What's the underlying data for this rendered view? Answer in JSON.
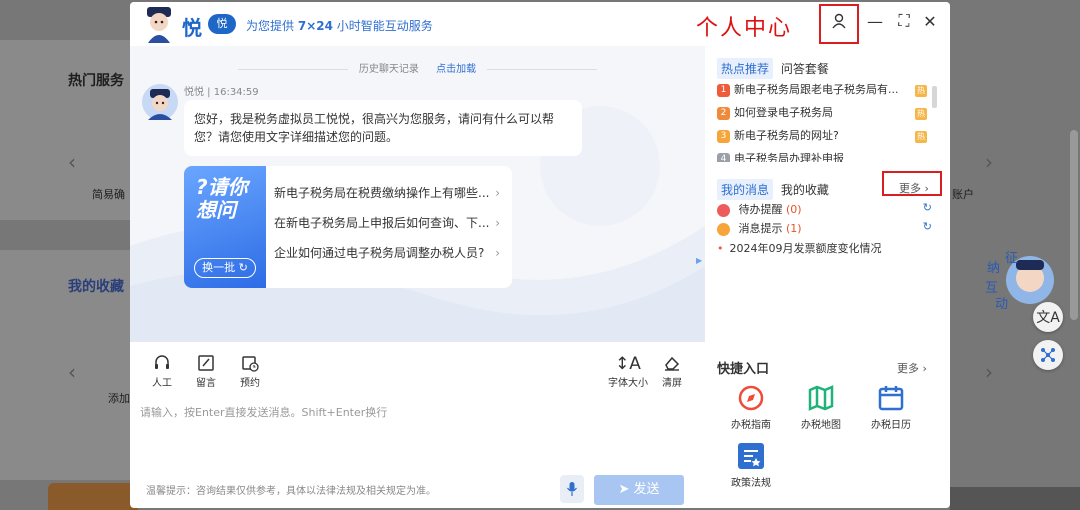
{
  "background": {
    "hot_services_label": "热门服务",
    "favorites_label": "我的收藏",
    "easy_label": "简易确",
    "add_label": "添加",
    "right_label": "账户"
  },
  "header": {
    "brand": "悦",
    "brand_badge": "悦",
    "tagline_prefix": "为您提供",
    "tagline_bold": "7×24",
    "tagline_suffix": "小时智能互动服务",
    "annotation": "个人中心",
    "user_icon": "person-icon",
    "minimize": "—",
    "maximize": "⛶",
    "close": "✕"
  },
  "chat": {
    "history_label": "历史聊天记录",
    "load_more": "点击加载",
    "sender": "悦悦 | 16:34:59",
    "greeting": "您好，我是税务虚拟员工悦悦，很高兴为您服务，请问有什么可以帮您？请您使用文字详细描述您的问题。",
    "card_title": "?请你想问",
    "refresh_button": "换一批",
    "questions": [
      "新电子税务局在税费缴纳操作上有哪些...",
      "在新电子税务局上申报后如何查询、下...",
      "企业如何通过电子税务局调整办税人员?"
    ]
  },
  "toolbar": {
    "tools": [
      {
        "label": "人工",
        "icon": "headset-icon"
      },
      {
        "label": "留言",
        "icon": "edit-icon"
      },
      {
        "label": "预约",
        "icon": "calendar-clock-icon"
      }
    ],
    "font_size": "字体大小",
    "clear": "清屏",
    "placeholder": "请输入，按Enter直接发送消息。Shift+Enter换行",
    "hint": "温馨提示：咨询结果仅供参考，具体以法律法规及相关规定为准。",
    "send": "发送"
  },
  "right_panel": {
    "hot_tab": "热点推荐",
    "package_tab": "问答套餐",
    "hot_items": [
      {
        "num": "1",
        "text": "新电子税务局跟老电子税务局有...",
        "color": "#ef5a3a"
      },
      {
        "num": "2",
        "text": "如何登录电子税务局",
        "color": "#f08a3a"
      },
      {
        "num": "3",
        "text": "新电子税务局的网址?",
        "color": "#f5a53a"
      },
      {
        "num": "4",
        "text": "电子税务局办理补申报",
        "color": "#9aa0a8"
      }
    ],
    "msg_tab": "我的消息",
    "fav_tab": "我的收藏",
    "more": "更多",
    "msg_items": [
      {
        "label": "待办提醒",
        "count": "(0)",
        "color": "#ef5a5a"
      },
      {
        "label": "消息提示",
        "count": "(1)",
        "color": "#f5a53a"
      }
    ],
    "notice": "2024年09月发票额度变化情况",
    "quick_title": "快捷入口",
    "quick_more": "更多",
    "quick_items": [
      {
        "label": "办税指南",
        "icon": "compass-icon",
        "color": "#ef4a3a"
      },
      {
        "label": "办税地图",
        "icon": "map-icon",
        "color": "#1fb37a"
      },
      {
        "label": "办税日历",
        "icon": "calendar-icon",
        "color": "#2f6fd0"
      },
      {
        "label": "政策法规",
        "icon": "policy-icon",
        "color": "#2f6fd0"
      }
    ]
  },
  "floating": {
    "avatar_text": "征纳互动",
    "translate_icon": "文A"
  }
}
